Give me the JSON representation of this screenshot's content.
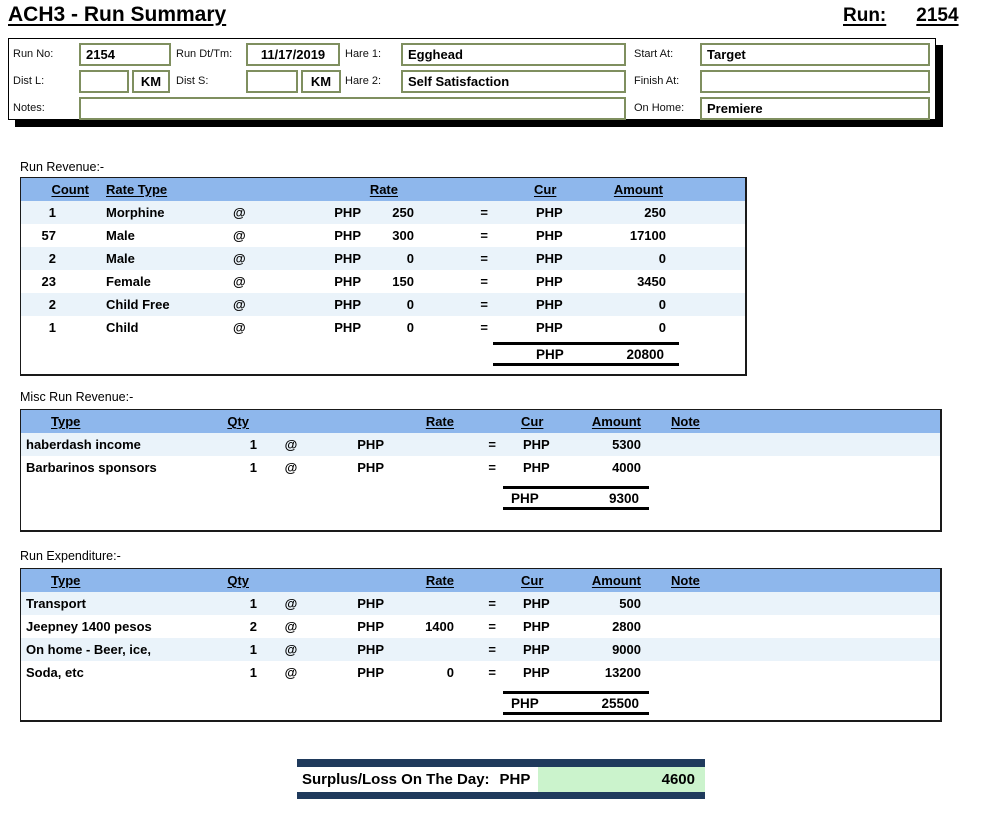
{
  "page": {
    "title": "ACH3 - Run Summary",
    "run_label": "Run:",
    "run_number": "2154"
  },
  "header": {
    "run_no_label": "Run No:",
    "run_no": "2154",
    "run_dt_label": "Run Dt/Tm:",
    "run_dt": "11/17/2019",
    "hare1_label": "Hare 1:",
    "hare1": "Egghead",
    "start_at_label": "Start At:",
    "start_at": "Target",
    "dist_l_label": "Dist L:",
    "dist_l": "",
    "dist_l_unit": "KM",
    "dist_s_label": "Dist S:",
    "dist_s": "",
    "dist_s_unit": "KM",
    "hare2_label": "Hare 2:",
    "hare2": "Self Satisfaction",
    "finish_at_label": "Finish At:",
    "finish_at": "",
    "notes_label": "Notes:",
    "notes": "",
    "on_home_label": "On Home:",
    "on_home": "Premiere"
  },
  "revenue": {
    "section_label": "Run Revenue:-",
    "headers": {
      "count": "Count",
      "type": "Rate Type",
      "rate": "Rate",
      "cur": "Cur",
      "amount": "Amount"
    },
    "rows": [
      {
        "count": "1",
        "type": "Morphine",
        "at": "@",
        "rate_cur": "PHP",
        "rate": "250",
        "eq": "=",
        "cur": "PHP",
        "amount": "250"
      },
      {
        "count": "57",
        "type": "Male",
        "at": "@",
        "rate_cur": "PHP",
        "rate": "300",
        "eq": "=",
        "cur": "PHP",
        "amount": "17100"
      },
      {
        "count": "2",
        "type": "Male",
        "at": "@",
        "rate_cur": "PHP",
        "rate": "0",
        "eq": "=",
        "cur": "PHP",
        "amount": "0"
      },
      {
        "count": "23",
        "type": "Female",
        "at": "@",
        "rate_cur": "PHP",
        "rate": "150",
        "eq": "=",
        "cur": "PHP",
        "amount": "3450"
      },
      {
        "count": "2",
        "type": "Child Free",
        "at": "@",
        "rate_cur": "PHP",
        "rate": "0",
        "eq": "=",
        "cur": "PHP",
        "amount": "0"
      },
      {
        "count": "1",
        "type": "Child",
        "at": "@",
        "rate_cur": "PHP",
        "rate": "0",
        "eq": "=",
        "cur": "PHP",
        "amount": "0"
      }
    ],
    "total": {
      "cur": "PHP",
      "amount": "20800"
    }
  },
  "misc": {
    "section_label": "Misc Run Revenue:-",
    "headers": {
      "type": "Type",
      "qty": "Qty",
      "rate": "Rate",
      "cur": "Cur",
      "amount": "Amount",
      "note": "Note"
    },
    "rows": [
      {
        "type": "haberdash income",
        "qty": "1",
        "at": "@",
        "rate_cur": "PHP",
        "rate": "",
        "eq": "=",
        "cur": "PHP",
        "amount": "5300",
        "note": ""
      },
      {
        "type": "Barbarinos sponsors",
        "qty": "1",
        "at": "@",
        "rate_cur": "PHP",
        "rate": "",
        "eq": "=",
        "cur": "PHP",
        "amount": "4000",
        "note": ""
      }
    ],
    "total": {
      "cur": "PHP",
      "amount": "9300"
    }
  },
  "expenditure": {
    "section_label": "Run Expenditure:-",
    "headers": {
      "type": "Type",
      "qty": "Qty",
      "rate": "Rate",
      "cur": "Cur",
      "amount": "Amount",
      "note": "Note"
    },
    "rows": [
      {
        "type": "Transport",
        "qty": "1",
        "at": "@",
        "rate_cur": "PHP",
        "rate": "",
        "eq": "=",
        "cur": "PHP",
        "amount": "500",
        "note": ""
      },
      {
        "type": "Jeepney 1400 pesos",
        "qty": "2",
        "at": "@",
        "rate_cur": "PHP",
        "rate": "1400",
        "eq": "=",
        "cur": "PHP",
        "amount": "2800",
        "note": ""
      },
      {
        "type": "On home - Beer, ice,",
        "qty": "1",
        "at": "@",
        "rate_cur": "PHP",
        "rate": "",
        "eq": "=",
        "cur": "PHP",
        "amount": "9000",
        "note": ""
      },
      {
        "type": "Soda, etc",
        "qty": "1",
        "at": "@",
        "rate_cur": "PHP",
        "rate": "0",
        "eq": "=",
        "cur": "PHP",
        "amount": "13200",
        "note": ""
      }
    ],
    "total": {
      "cur": "PHP",
      "amount": "25500"
    }
  },
  "surplus": {
    "label": "Surplus/Loss On The Day:",
    "cur": "PHP",
    "amount": "4600"
  },
  "colors": {
    "table_header_blue": "#8EB7EC",
    "row_alt_blue": "#EAF3FA",
    "navy": "#1F3A5C",
    "surplus_green": "#CBF3CC",
    "input_border_olive": "#7F8F5F"
  }
}
